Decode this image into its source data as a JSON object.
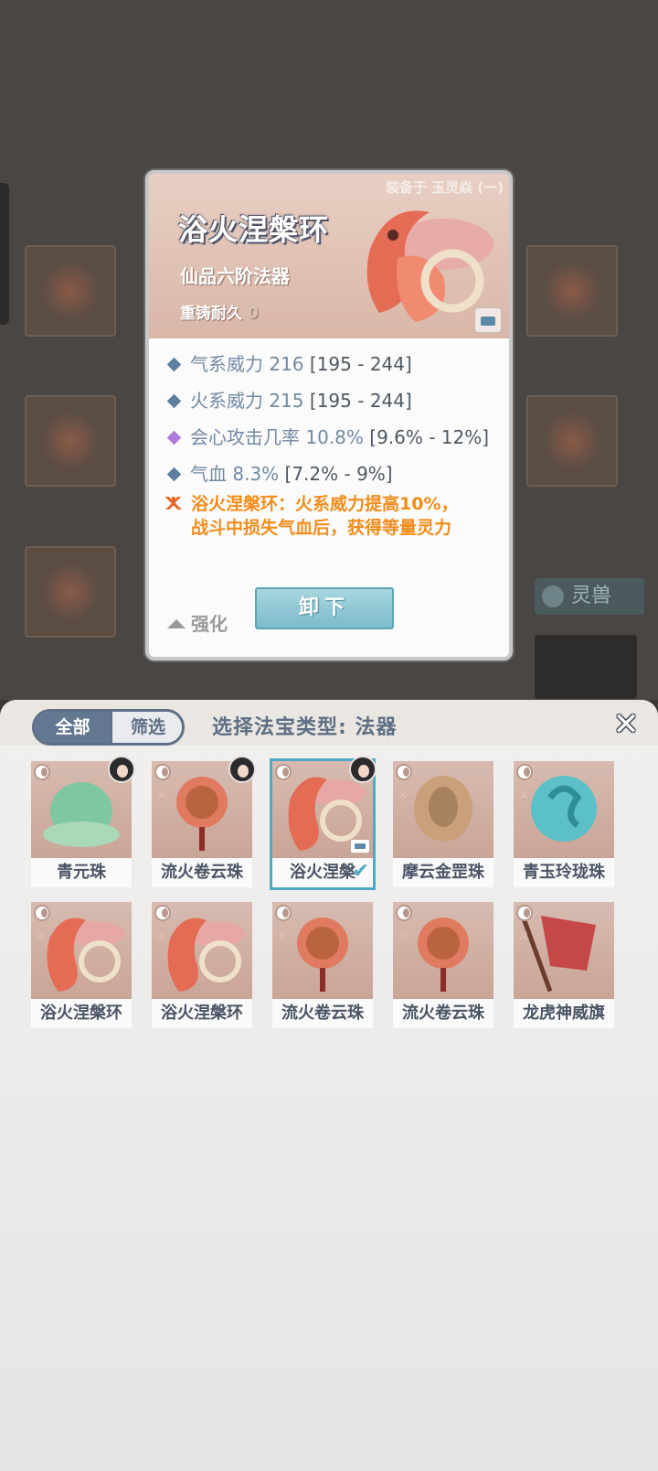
{
  "detail": {
    "equipped_by": "装备于 玉灵焱 (一)",
    "name": "浴火涅槃环",
    "grade": "仙品六阶法器",
    "reforge_label": "重铸耐久",
    "reforge_value": "0",
    "stats": [
      {
        "name": "气系威力",
        "value": "216",
        "range": "[195 - 244]",
        "color": "#5e7ea0"
      },
      {
        "name": "火系威力",
        "value": "215",
        "range": "[195 - 244]",
        "color": "#5e7ea0"
      },
      {
        "name": "会心攻击几率",
        "value": "10.8%",
        "range": "[9.6% - 12%]",
        "color": "#b07ad8"
      },
      {
        "name": "气血",
        "value": "8.3%",
        "range": "[7.2% - 9%]",
        "color": "#5e7ea0"
      }
    ],
    "effect_line1": "浴火涅槃环：火系威力提高10%，",
    "effect_line2": "战斗中损失气血后，获得等量灵力",
    "strengthen_label": "强化",
    "unequip_label": "卸下"
  },
  "background": {
    "beast_label": "灵兽"
  },
  "sheet": {
    "tab_all": "全部",
    "tab_filter": "筛选",
    "title": "选择法宝类型: 法器",
    "close_icon": "close-icon"
  },
  "items": [
    {
      "label": "青元珠",
      "art_color": "#7fc7a0",
      "owner": true,
      "fire": false
    },
    {
      "label": "流火卷云珠",
      "art_color": "#e07a60",
      "owner": true,
      "fire": true
    },
    {
      "label": "浴火涅槃",
      "art_color": "#e98a74",
      "owner": true,
      "fire": false,
      "selected": true
    },
    {
      "label": "摩云金罡珠",
      "art_color": "#c9a07a",
      "owner": false,
      "fire": true
    },
    {
      "label": "青玉玲珑珠",
      "art_color": "#5cc0c8",
      "owner": false,
      "fire": true
    },
    {
      "label": "浴火涅槃环",
      "art_color": "#e98a74",
      "owner": false,
      "fire": true
    },
    {
      "label": "浴火涅槃环",
      "art_color": "#e98a74",
      "owner": false,
      "fire": true
    },
    {
      "label": "流火卷云珠",
      "art_color": "#e07a60",
      "owner": false,
      "fire": true
    },
    {
      "label": "流火卷云珠",
      "art_color": "#e07a60",
      "owner": false,
      "fire": true
    },
    {
      "label": "龙虎神威旗",
      "art_color": "#c44848",
      "owner": false,
      "fire": true
    }
  ]
}
